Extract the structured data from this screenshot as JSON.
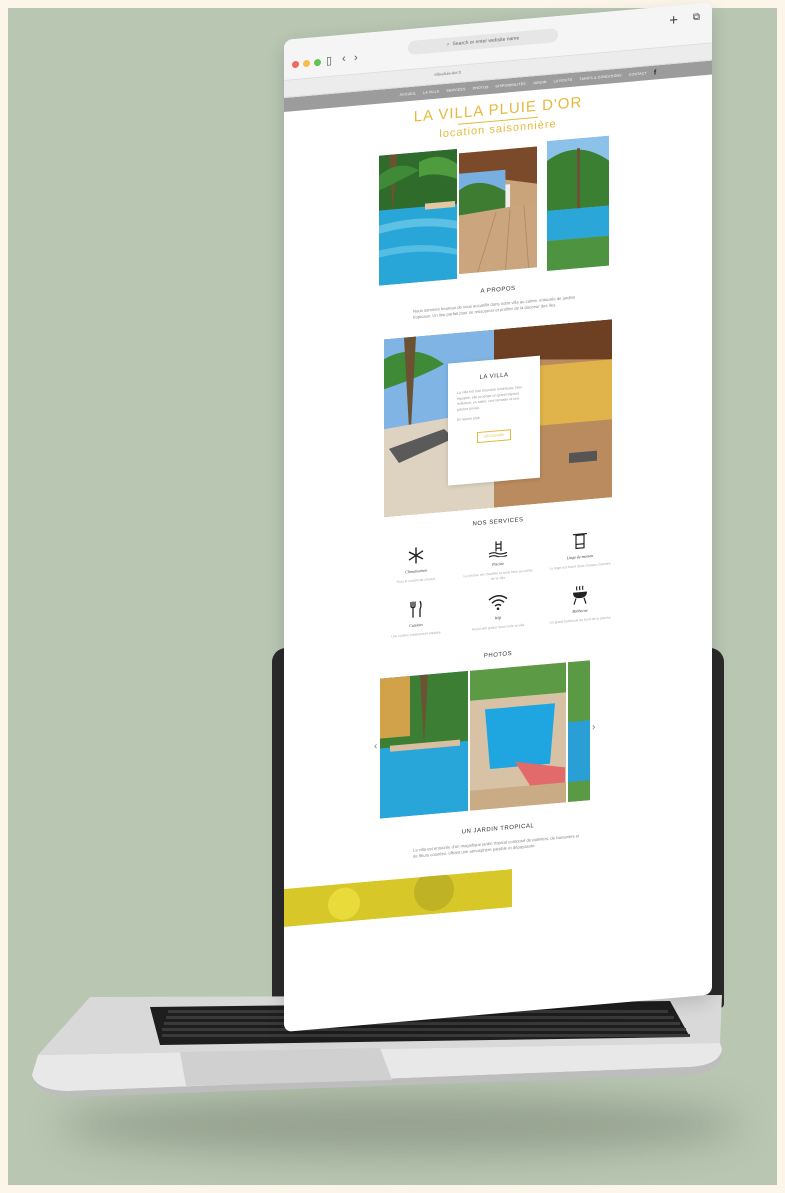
{
  "browser": {
    "address_placeholder": "Search or enter website name",
    "url": "villa-pluie-dor.fr",
    "plus_glyph": "+",
    "tabs_glyph": "⧉"
  },
  "nav": {
    "items": [
      "ACCUEIL",
      "LA VILLA",
      "SERVICES",
      "PHOTOS",
      "DISPONIBILITÉS",
      "JARDIN",
      "LA ROUTE",
      "TARIFS & CONDITIONS",
      "CONTACT"
    ],
    "facebook": "f"
  },
  "logo": {
    "line1": "LA VILLA PLUIE D'OR",
    "line2": "location saisonnière"
  },
  "about": {
    "title": "A PROPOS",
    "text": "Nous sommes heureux de vous accueillir dans notre villa au calme, entourée de jardins tropicaux. Un lieu parfait pour se ressourcer et profiter de la douceur des îles."
  },
  "villa": {
    "title": "LA VILLA",
    "p1": "La villa est une structure lumineuse, bien équipée, elle propose un grand espace extérieur, un salon, une terrasse et une piscine privée.",
    "p2": "En savoir plus",
    "button": "DÉCOUVRIR"
  },
  "services": {
    "title": "NOS SERVICES",
    "items": [
      {
        "name": "Climatisation",
        "desc": "Pour le confort de chacun"
      },
      {
        "name": "Piscine",
        "desc": "La piscine est chauffée et reste bien au calme de la villa"
      },
      {
        "name": "Linge de maison",
        "desc": "Le linge est fourni dans chaque chambre"
      },
      {
        "name": "Cuisines",
        "desc": "Une cuisine entièrement équipée"
      },
      {
        "name": "Wifi",
        "desc": "Accès wifi gratuit dans toute la villa"
      },
      {
        "name": "Barbecue",
        "desc": "Un grand barbecue au bord de la piscine"
      }
    ]
  },
  "photos": {
    "title": "PHOTOS",
    "prev": "‹",
    "next": "›"
  },
  "garden": {
    "title": "UN JARDIN TROPICAL",
    "text": "La villa est entourée d'un magnifique jardin tropical composé de palmiers, de bananiers et de fleurs colorées, offrant une atmosphère paisible et dépaysante."
  },
  "colors": {
    "accent_gold": "#e5b93c",
    "nav_gray": "#9c9c9c",
    "backdrop": "#b8c6b2",
    "frame": "#fbf6e9"
  }
}
